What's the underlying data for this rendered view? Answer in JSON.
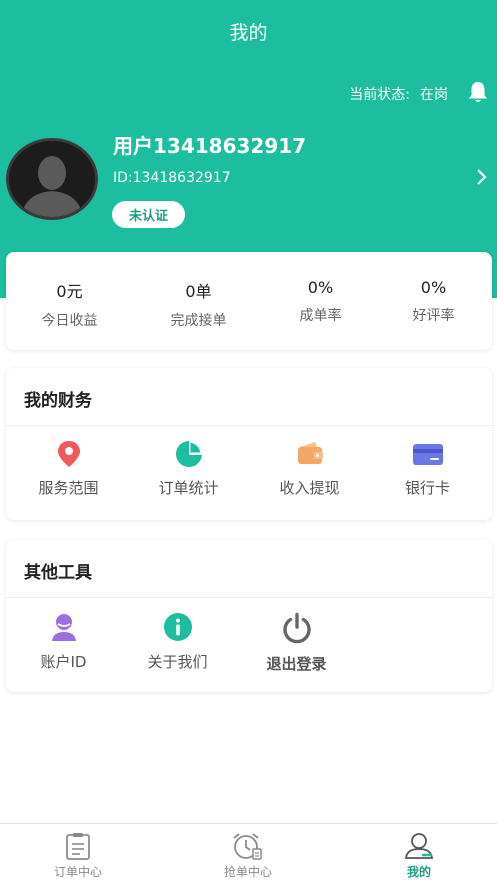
{
  "header": {
    "title": "我的",
    "status_label": "当前状态:",
    "status_value": "在岗"
  },
  "profile": {
    "username": "用户13418632917",
    "user_id": "ID:13418632917",
    "verification_badge": "未认证"
  },
  "stats": [
    {
      "value": "0元",
      "label": "今日收益"
    },
    {
      "value": "0单",
      "label": "完成接单"
    },
    {
      "value": "0%",
      "label": "成单率"
    },
    {
      "value": "0%",
      "label": "好评率"
    }
  ],
  "finance": {
    "title": "我的财务",
    "items": [
      {
        "label": "服务范围",
        "icon": "location-pin-icon"
      },
      {
        "label": "订单统计",
        "icon": "pie-chart-icon"
      },
      {
        "label": "收入提现",
        "icon": "wallet-icon"
      },
      {
        "label": "银行卡",
        "icon": "bank-card-icon"
      }
    ]
  },
  "tools": {
    "title": "其他工具",
    "items": [
      {
        "label": "账户ID",
        "icon": "account-icon"
      },
      {
        "label": "关于我们",
        "icon": "info-icon"
      },
      {
        "label": "退出登录",
        "icon": "power-icon"
      }
    ]
  },
  "tabbar": {
    "items": [
      {
        "label": "订单中心",
        "icon": "clipboard-icon"
      },
      {
        "label": "抢单中心",
        "icon": "alarm-clock-icon"
      },
      {
        "label": "我的",
        "icon": "user-icon"
      }
    ],
    "active_index": 2
  },
  "colors": {
    "primary": "#1dbd9f",
    "active_tab": "#1a9e86",
    "location": "#ef5a5a",
    "chart": "#1dbd9f",
    "wallet": "#f5a766",
    "bank_card": "#6b76e8",
    "account": "#9b6fe0",
    "info": "#1dbd9f",
    "power": "#666666"
  }
}
